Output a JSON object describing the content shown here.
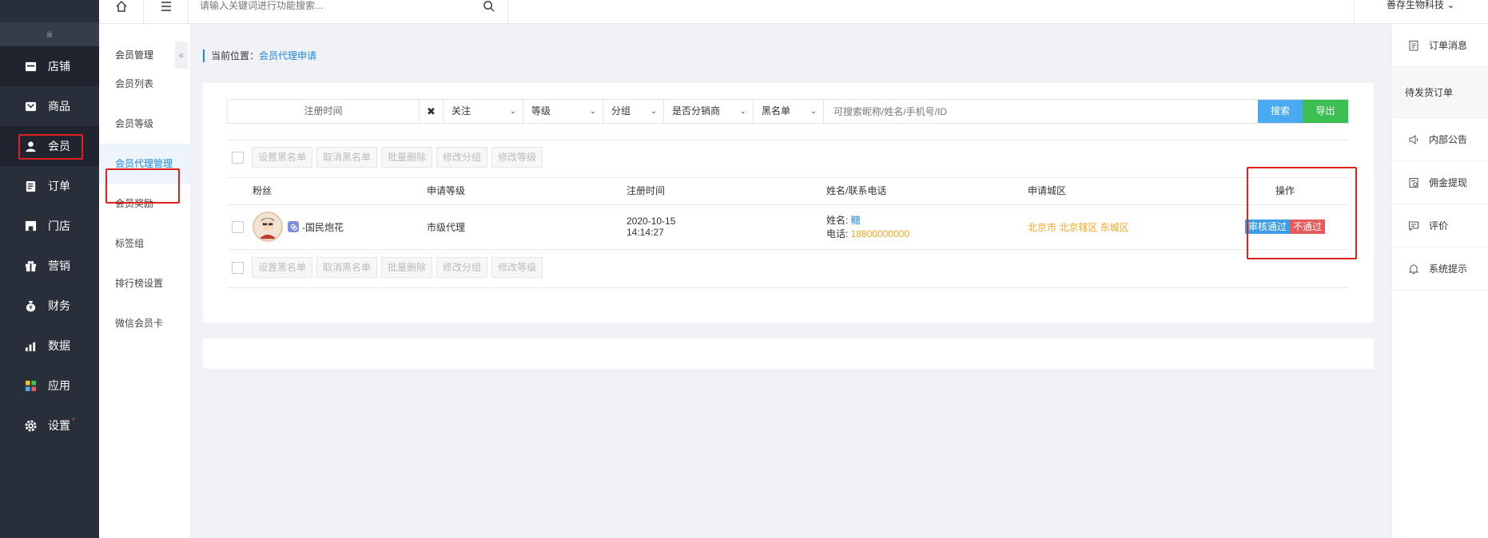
{
  "sidebar": {
    "collapse_icon": "list-collapse-icon",
    "items": [
      {
        "label": "店铺",
        "icon": "shop-icon"
      },
      {
        "label": "商品",
        "icon": "goods-icon"
      },
      {
        "label": "会员",
        "icon": "user-icon"
      },
      {
        "label": "订单",
        "icon": "order-icon"
      },
      {
        "label": "门店",
        "icon": "store-icon"
      },
      {
        "label": "营销",
        "icon": "gift-icon"
      },
      {
        "label": "财务",
        "icon": "money-bag-icon"
      },
      {
        "label": "数据",
        "icon": "chart-icon"
      },
      {
        "label": "应用",
        "icon": "apps-icon"
      },
      {
        "label": "设置",
        "icon": "gear-icon",
        "badge": "*"
      }
    ]
  },
  "topbar": {
    "search_placeholder": "请输入关键词进行功能搜索...",
    "company": "善存生物科技 ⌄"
  },
  "submenu": {
    "title": "会员管理",
    "fold_icon": "«",
    "items": [
      "会员列表",
      "会员等级",
      "会员代理管理",
      "会员奖励",
      "标签组",
      "排行榜设置",
      "微信会员卡"
    ]
  },
  "rpanel": {
    "items": [
      "订单消息",
      "待发货订单",
      "内部公告",
      "佣金提现",
      "评价",
      "系统提示"
    ]
  },
  "breadcrumb": {
    "prefix": "当前位置：",
    "current": "会员代理申请"
  },
  "filter": {
    "date": "注册时间",
    "clear": "✖",
    "selects": [
      "关注",
      "等级",
      "分组",
      "是否分销商",
      "黑名单"
    ],
    "input_placeholder": "可搜索昵称/姓名/手机号/ID",
    "search": "搜索",
    "export": "导出"
  },
  "actions": [
    "设置黑名单",
    "取消黑名单",
    "批量删除",
    "修改分组",
    "修改等级"
  ],
  "table": {
    "headers": [
      "粉丝",
      "申请等级",
      "注册时间",
      "姓名/联系电话",
      "申请城区",
      "操作"
    ],
    "row": {
      "fan": "-国民炮花",
      "level": "市级代理",
      "date": "2020-10-15",
      "time": "14:14:27",
      "name_label": "姓名: ",
      "name": "糖",
      "phone_label": "电话: ",
      "phone": "18800000000",
      "city": "北京市 北京辖区 东城区",
      "pass": "审核通过",
      "fail": "不通过"
    }
  }
}
